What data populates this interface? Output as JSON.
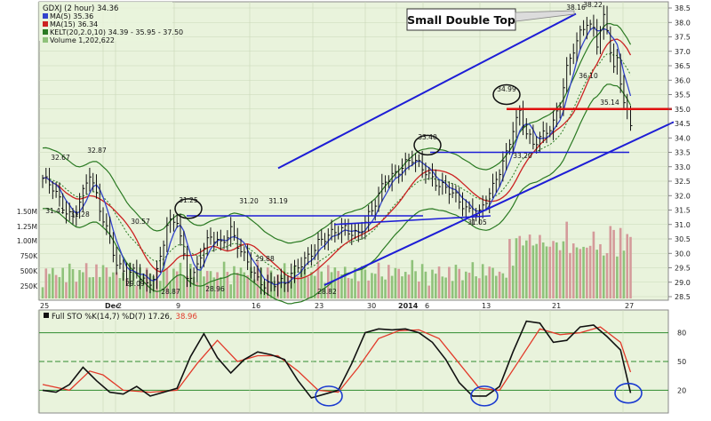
{
  "header": {
    "symbol_line": "GDXJ (2 hour) 34.36",
    "ma5_line": "MA(5) 35.36",
    "ma15_line": "MA(15) 36.34",
    "kelt_line": "KELT(20,2.0,10) 34.39 - 35.95 - 37.50",
    "volume_line": "Volume 1,202,622"
  },
  "colors": {
    "panel_bg": "#e9f3dc",
    "grid": "#c9d8b8",
    "candle": "#111111",
    "ma5": "#3344cc",
    "ma15": "#cc2222",
    "kelt_band": "#2a7a22",
    "kelt_mid": "#2a7a22",
    "trendline": "#1d1dd6",
    "resistance": "#e01010",
    "vol_up": "#8fc27a",
    "vol_down": "#d49a9a",
    "sto_k": "#111111",
    "sto_d": "#e23a2a",
    "sto_line": "#2e8b2e",
    "callout_circle": "#111111",
    "sto_circle": "#1a3ad0"
  },
  "annotation": "Small Double Top",
  "price_callouts": [
    {
      "label": "34.99"
    },
    {
      "label": "33.40"
    },
    {
      "label": "31.25"
    }
  ],
  "chart_data": [
    {
      "type": "candlestick",
      "title": "GDXJ (2 hour) 34.36",
      "ylim": [
        28.5,
        38.5
      ],
      "y_ticks": [
        "28.5",
        "29.0",
        "29.5",
        "30.0",
        "30.5",
        "31.0",
        "31.5",
        "32.0",
        "32.5",
        "33.0",
        "33.5",
        "34.0",
        "34.5",
        "35.0",
        "35.5",
        "36.0",
        "36.5",
        "37.0",
        "37.5",
        "38.0",
        "38.5"
      ],
      "x_tick_labels": [
        "25",
        "Dec",
        "2",
        "9",
        "16",
        "23",
        "30",
        "2014",
        "6",
        "13",
        "21",
        "27"
      ],
      "volume_ticks": [
        "1.50M",
        "1.25M",
        "1.00M",
        "750K",
        "500K",
        "250K"
      ],
      "legend": [
        "MA(5) 35.36",
        "MA(15) 36.34",
        "KELT(20,2.0,10) 34.39 - 35.95 - 37.50",
        "Volume 1,202,622"
      ],
      "data_labels": [
        {
          "text": "32.67",
          "value": 32.67
        },
        {
          "text": "32.87",
          "value": 32.87
        },
        {
          "text": "31.41",
          "value": 31.41
        },
        {
          "text": "31.28",
          "value": 31.28
        },
        {
          "text": "30.57",
          "value": 30.57
        },
        {
          "text": "29.09",
          "value": 29.09
        },
        {
          "text": "28.87",
          "value": 28.87
        },
        {
          "text": "31.25",
          "value": 31.25
        },
        {
          "text": "28.96",
          "value": 28.96
        },
        {
          "text": "31.20",
          "value": 31.2
        },
        {
          "text": "31.19",
          "value": 31.19
        },
        {
          "text": "29.88",
          "value": 29.88
        },
        {
          "text": "28.82",
          "value": 28.82
        },
        {
          "text": "33.40",
          "value": 33.4
        },
        {
          "text": "31.05",
          "value": 31.05
        },
        {
          "text": "34.99",
          "value": 34.99
        },
        {
          "text": "33.20",
          "value": 33.2
        },
        {
          "text": "38.16",
          "value": 38.16
        },
        {
          "text": "38.22",
          "value": 38.22
        },
        {
          "text": "36.10",
          "value": 36.1
        },
        {
          "text": "35.14",
          "value": 35.14
        }
      ],
      "close_path": [
        {
          "bar": 0,
          "close": 32.6
        },
        {
          "bar": 3,
          "close": 32.2
        },
        {
          "bar": 6,
          "close": 31.6
        },
        {
          "bar": 9,
          "close": 31.3
        },
        {
          "bar": 12,
          "close": 32.1
        },
        {
          "bar": 14,
          "close": 32.7
        },
        {
          "bar": 17,
          "close": 31.5
        },
        {
          "bar": 20,
          "close": 30.6
        },
        {
          "bar": 22,
          "close": 29.7
        },
        {
          "bar": 25,
          "close": 29.2
        },
        {
          "bar": 28,
          "close": 29.3
        },
        {
          "bar": 31,
          "close": 28.95
        },
        {
          "bar": 34,
          "close": 29.4
        },
        {
          "bar": 37,
          "close": 30.9
        },
        {
          "bar": 40,
          "close": 31.1
        },
        {
          "bar": 43,
          "close": 29.3
        },
        {
          "bar": 45,
          "close": 29.3
        },
        {
          "bar": 47,
          "close": 30.0
        },
        {
          "bar": 50,
          "close": 30.5
        },
        {
          "bar": 53,
          "close": 30.3
        },
        {
          "bar": 56,
          "close": 30.9
        },
        {
          "bar": 59,
          "close": 30.1
        },
        {
          "bar": 62,
          "close": 29.4
        },
        {
          "bar": 64,
          "close": 29.0
        },
        {
          "bar": 66,
          "close": 28.95
        },
        {
          "bar": 68,
          "close": 29.0
        },
        {
          "bar": 70,
          "close": 29.1
        },
        {
          "bar": 72,
          "close": 28.9
        },
        {
          "bar": 74,
          "close": 29.2
        },
        {
          "bar": 78,
          "close": 29.8
        },
        {
          "bar": 82,
          "close": 30.4
        },
        {
          "bar": 86,
          "close": 30.6
        },
        {
          "bar": 90,
          "close": 30.9
        },
        {
          "bar": 94,
          "close": 30.7
        },
        {
          "bar": 98,
          "close": 31.4
        },
        {
          "bar": 102,
          "close": 32.6
        },
        {
          "bar": 106,
          "close": 32.9
        },
        {
          "bar": 110,
          "close": 33.2
        },
        {
          "bar": 114,
          "close": 32.9
        },
        {
          "bar": 118,
          "close": 32.4
        },
        {
          "bar": 122,
          "close": 32.0
        },
        {
          "bar": 126,
          "close": 31.6
        },
        {
          "bar": 130,
          "close": 31.4
        },
        {
          "bar": 134,
          "close": 32.2
        },
        {
          "bar": 138,
          "close": 33.5
        },
        {
          "bar": 140,
          "close": 34.4
        },
        {
          "bar": 142,
          "close": 34.9
        },
        {
          "bar": 144,
          "close": 34.1
        },
        {
          "bar": 146,
          "close": 33.7
        },
        {
          "bar": 148,
          "close": 34.0
        },
        {
          "bar": 150,
          "close": 34.3
        },
        {
          "bar": 152,
          "close": 34.6
        },
        {
          "bar": 154,
          "close": 35.2
        },
        {
          "bar": 156,
          "close": 36.3
        },
        {
          "bar": 158,
          "close": 37.0
        },
        {
          "bar": 160,
          "close": 37.6
        },
        {
          "bar": 162,
          "close": 38.1
        },
        {
          "bar": 164,
          "close": 37.8
        },
        {
          "bar": 165,
          "close": 37.3
        },
        {
          "bar": 166,
          "close": 37.8
        },
        {
          "bar": 167,
          "close": 38.1
        },
        {
          "bar": 168,
          "close": 37.6
        },
        {
          "bar": 169,
          "close": 37.0
        },
        {
          "bar": 170,
          "close": 36.4
        },
        {
          "bar": 171,
          "close": 36.6
        },
        {
          "bar": 172,
          "close": 35.9
        },
        {
          "bar": 173,
          "close": 35.4
        },
        {
          "bar": 174,
          "close": 35.0
        },
        {
          "bar": 175,
          "close": 34.4
        }
      ],
      "overlay_ma5_desc": "blue line",
      "overlay_ma15_desc": "red line",
      "overlay_keltner_desc": "green bands with dotted middle line",
      "resistance_level": 35.0,
      "support_level_1": 33.5,
      "support_level_2": 31.3,
      "channel": "ascending blue channel lines"
    },
    {
      "type": "line",
      "title": "Full STO %K(14,7) %D(7) 17.26, 38.96",
      "title_prefix": "Full STO %K(14,7) %D(7) 17.26,",
      "title_value": "38.96",
      "ylim": [
        0,
        100
      ],
      "y_ticks": [
        "80",
        "50",
        "20"
      ],
      "ref_lines": [
        80,
        50,
        20
      ],
      "series": [
        {
          "name": "%K",
          "color": "#111111"
        },
        {
          "name": "%D",
          "color": "#e23a2a"
        }
      ],
      "stoch_k": [
        {
          "bar": 0,
          "value": 20
        },
        {
          "bar": 4,
          "value": 18
        },
        {
          "bar": 8,
          "value": 26
        },
        {
          "bar": 12,
          "value": 44
        },
        {
          "bar": 16,
          "value": 30
        },
        {
          "bar": 20,
          "value": 18
        },
        {
          "bar": 24,
          "value": 16
        },
        {
          "bar": 28,
          "value": 24
        },
        {
          "bar": 32,
          "value": 14
        },
        {
          "bar": 36,
          "value": 18
        },
        {
          "bar": 40,
          "value": 22
        },
        {
          "bar": 44,
          "value": 55
        },
        {
          "bar": 48,
          "value": 79
        },
        {
          "bar": 52,
          "value": 54
        },
        {
          "bar": 56,
          "value": 38
        },
        {
          "bar": 60,
          "value": 52
        },
        {
          "bar": 64,
          "value": 60
        },
        {
          "bar": 68,
          "value": 57
        },
        {
          "bar": 72,
          "value": 52
        },
        {
          "bar": 76,
          "value": 30
        },
        {
          "bar": 80,
          "value": 12
        },
        {
          "bar": 84,
          "value": 16
        },
        {
          "bar": 88,
          "value": 20
        },
        {
          "bar": 92,
          "value": 48
        },
        {
          "bar": 96,
          "value": 80
        },
        {
          "bar": 100,
          "value": 84
        },
        {
          "bar": 104,
          "value": 83
        },
        {
          "bar": 108,
          "value": 84
        },
        {
          "bar": 112,
          "value": 80
        },
        {
          "bar": 116,
          "value": 70
        },
        {
          "bar": 120,
          "value": 52
        },
        {
          "bar": 124,
          "value": 28
        },
        {
          "bar": 128,
          "value": 14
        },
        {
          "bar": 132,
          "value": 14
        },
        {
          "bar": 136,
          "value": 24
        },
        {
          "bar": 140,
          "value": 60
        },
        {
          "bar": 144,
          "value": 92
        },
        {
          "bar": 148,
          "value": 90
        },
        {
          "bar": 152,
          "value": 70
        },
        {
          "bar": 156,
          "value": 72
        },
        {
          "bar": 160,
          "value": 86
        },
        {
          "bar": 164,
          "value": 88
        },
        {
          "bar": 168,
          "value": 76
        },
        {
          "bar": 172,
          "value": 62
        },
        {
          "bar": 175,
          "value": 17.26
        }
      ],
      "stoch_d": [
        {
          "bar": 0,
          "value": 26
        },
        {
          "bar": 8,
          "value": 20
        },
        {
          "bar": 14,
          "value": 40
        },
        {
          "bar": 18,
          "value": 36
        },
        {
          "bar": 24,
          "value": 20
        },
        {
          "bar": 32,
          "value": 18
        },
        {
          "bar": 40,
          "value": 20
        },
        {
          "bar": 46,
          "value": 48
        },
        {
          "bar": 52,
          "value": 72
        },
        {
          "bar": 58,
          "value": 50
        },
        {
          "bar": 64,
          "value": 56
        },
        {
          "bar": 70,
          "value": 56
        },
        {
          "bar": 76,
          "value": 40
        },
        {
          "bar": 82,
          "value": 20
        },
        {
          "bar": 88,
          "value": 18
        },
        {
          "bar": 94,
          "value": 44
        },
        {
          "bar": 100,
          "value": 74
        },
        {
          "bar": 106,
          "value": 82
        },
        {
          "bar": 112,
          "value": 83
        },
        {
          "bar": 118,
          "value": 74
        },
        {
          "bar": 124,
          "value": 48
        },
        {
          "bar": 130,
          "value": 22
        },
        {
          "bar": 136,
          "value": 20
        },
        {
          "bar": 142,
          "value": 52
        },
        {
          "bar": 148,
          "value": 84
        },
        {
          "bar": 154,
          "value": 78
        },
        {
          "bar": 160,
          "value": 80
        },
        {
          "bar": 166,
          "value": 86
        },
        {
          "bar": 172,
          "value": 70
        },
        {
          "bar": 175,
          "value": 38.96
        }
      ]
    }
  ]
}
